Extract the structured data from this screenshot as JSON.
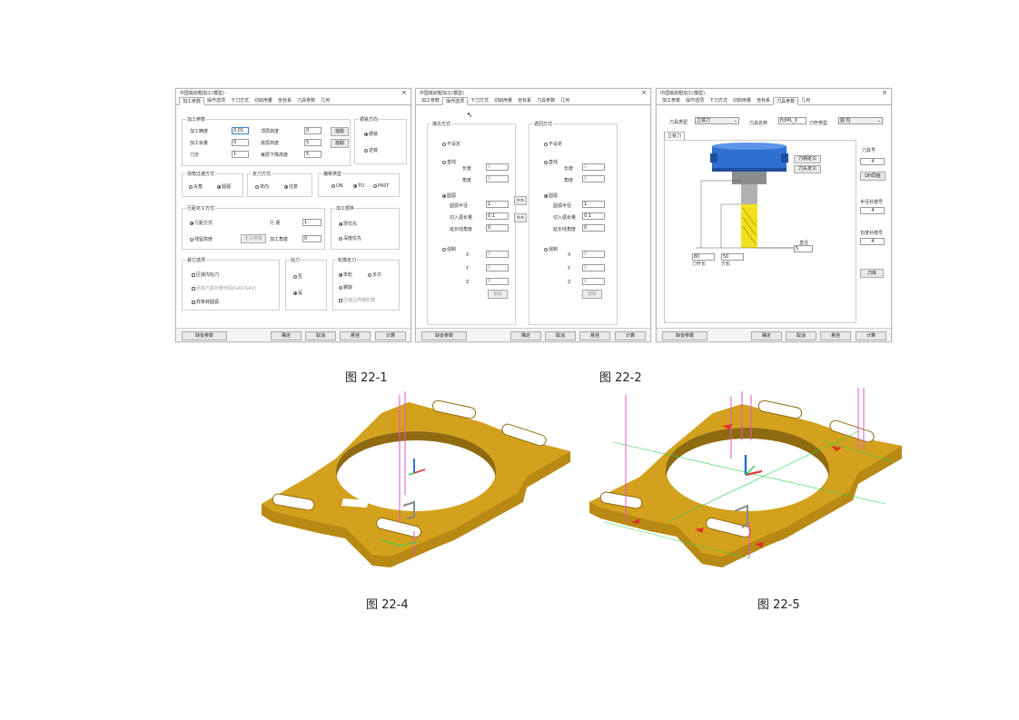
{
  "dialog_title": "中国铣削粗加工(模型)",
  "tabs": [
    "加工参数",
    "操作选项",
    "下刀方式",
    "切削用量",
    "坐标系",
    "刀具参数",
    "几何"
  ],
  "footer": {
    "params": "缺省参数",
    "ok": "确定",
    "cancel": "取消",
    "apply": "悬挂",
    "calc": "计算"
  },
  "d1": {
    "machining_params": "加工参数",
    "precision_label": "加工精度",
    "precision_val": "0.01",
    "step_down_label": "顶层高度",
    "step_down_val": "0",
    "allowance_label": "加工余量",
    "allowance_val": "0",
    "depth_label": "底层高度",
    "depth_val": "5",
    "tool_label": "刀次",
    "tool_val": "1",
    "layer_label": "每层下降高度",
    "layer_val": "5",
    "pick1": "拾取",
    "pick2": "拾取",
    "rotate_title": "顺铣方向",
    "rot_a": "顺铣",
    "rot_b": "逆铣",
    "cut_title": "拐角过渡方式",
    "cut_a": "尖角",
    "cut_b": "圆弧",
    "dir_title": "走刀方式",
    "dir_a": "单向",
    "dir_b": "往复",
    "off_title": "偏移类型",
    "off_a": "ON",
    "off_b": "TO",
    "off_c": "PAST",
    "path_title": "行距定义方式",
    "path_a": "行距方式",
    "path_b": "残留高度",
    "path_btn": "定义参数",
    "row_label": "行 距",
    "row_val": "1",
    "resid_label": "加工角度",
    "resid_val": "0",
    "order_title": "加工顺序",
    "order_a": "层优先",
    "order_b": "深度优先",
    "other_title": "其它选项",
    "other_a": "区域内抬刀",
    "other_b": "添加刀具补偿代码(G41/G42)",
    "other_c": "样条转圆弧",
    "retract_title": "抬刀",
    "retract_a": "否",
    "retract_b": "是",
    "extra_title": "轮廓走刀",
    "extra_a": "单轮",
    "extra_b": "多次",
    "extra_c": "螺旋",
    "extra_d": "区域边界做轮廓"
  },
  "d2": {
    "enter_title": "接近方式",
    "exit_title": "返回方式",
    "opt_none": "不设定",
    "opt_line": "直线",
    "opt_arc": "圆弧",
    "opt_pt": "强制",
    "len": "长度",
    "ang": "角度",
    "len_v": "2",
    "ang_v": "0",
    "r": "圆弧半径",
    "r_v": "1",
    "sa": "切入弧长量",
    "sa_v": "0.1",
    "da": "延长线角度",
    "da_v": "0",
    "x": "X",
    "y": "Y",
    "z": "Z",
    "x_v": "0",
    "y_v": "0",
    "z_v": "0",
    "pick": "拾取",
    "arr1": ">>",
    "arr2": "<<"
  },
  "d3": {
    "tool_type_label": "刀具类型",
    "tool_type_val": "立铣刀",
    "tool_name_label": "刀具名称",
    "tool_name_val": "EdML_0",
    "tool_kind_label": "刀杆类型",
    "tool_kind_val": "圆 柱",
    "subtab": "立铣刀",
    "r1": "刀柄定义",
    "r2": "刀头定义",
    "d_lbl": "直径",
    "d_val": "5",
    "len1_val": "80",
    "len1_lbl": "刀杆长",
    "len2_val": "50",
    "len2_lbl": "刃长",
    "no_lbl": "刀具号",
    "no_val": "4",
    "save_btn": "DH同值",
    "rad_lbl": "半径补偿号",
    "rad_val": "4",
    "len_lbl": "长度补偿号",
    "len_val": "4",
    "lib_btn": "刀库"
  },
  "captions": [
    "图 22-1",
    "图 22-2",
    "图 22-4",
    "图 22-5"
  ],
  "colors": {
    "part": "#d4a11e",
    "part_dark": "#8f6a10",
    "part_side": "#b88914",
    "holder": "#2f6fd1",
    "shank": "#9a9a9a",
    "blade": "#f2e01f",
    "pink": "#e055c8",
    "green": "#2bd64a",
    "red": "#e0302a"
  }
}
